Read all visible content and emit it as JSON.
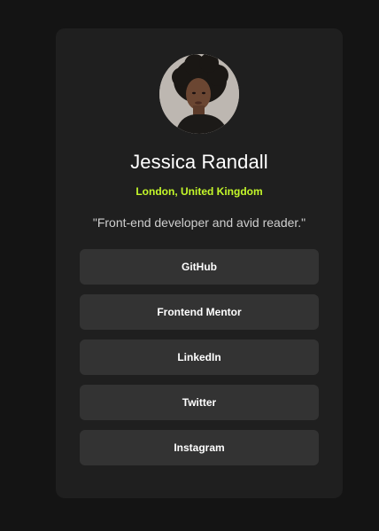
{
  "profile": {
    "name": "Jessica Randall",
    "location": "London, United Kingdom",
    "bio": "\"Front-end developer and avid reader.\""
  },
  "links": [
    {
      "label": "GitHub"
    },
    {
      "label": "Frontend Mentor"
    },
    {
      "label": "LinkedIn"
    },
    {
      "label": "Twitter"
    },
    {
      "label": "Instagram"
    }
  ],
  "colors": {
    "page_background": "#141414",
    "card_background": "#1f1f1f",
    "button_background": "#333333",
    "accent": "#c4f82a",
    "text": "#ffffff"
  }
}
